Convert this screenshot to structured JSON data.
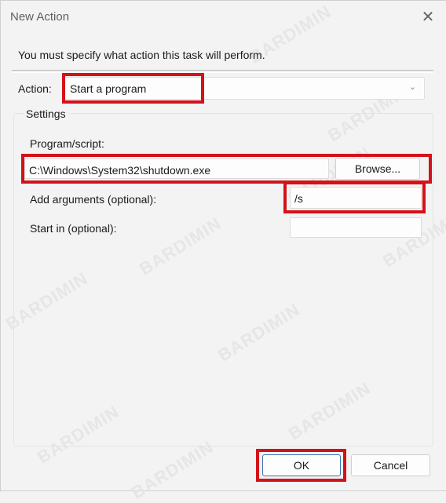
{
  "window": {
    "title": "New Action"
  },
  "icons": {
    "close": "close-icon",
    "dropdown": "chevron-down-icon"
  },
  "instruction": "You must specify what action this task will perform.",
  "action": {
    "label": "Action:",
    "value": "Start a program"
  },
  "settings": {
    "title": "Settings",
    "program_label": "Program/script:",
    "program_value": "C:\\Windows\\System32\\shutdown.exe",
    "browse_label": "Browse...",
    "args_label": "Add arguments (optional):",
    "args_value": "/s",
    "startin_label": "Start in (optional):",
    "startin_value": ""
  },
  "buttons": {
    "ok": "OK",
    "cancel": "Cancel"
  },
  "watermark": "BARDIMIN",
  "colors": {
    "highlight": "#d3121a",
    "background": "#f3f3f3"
  }
}
